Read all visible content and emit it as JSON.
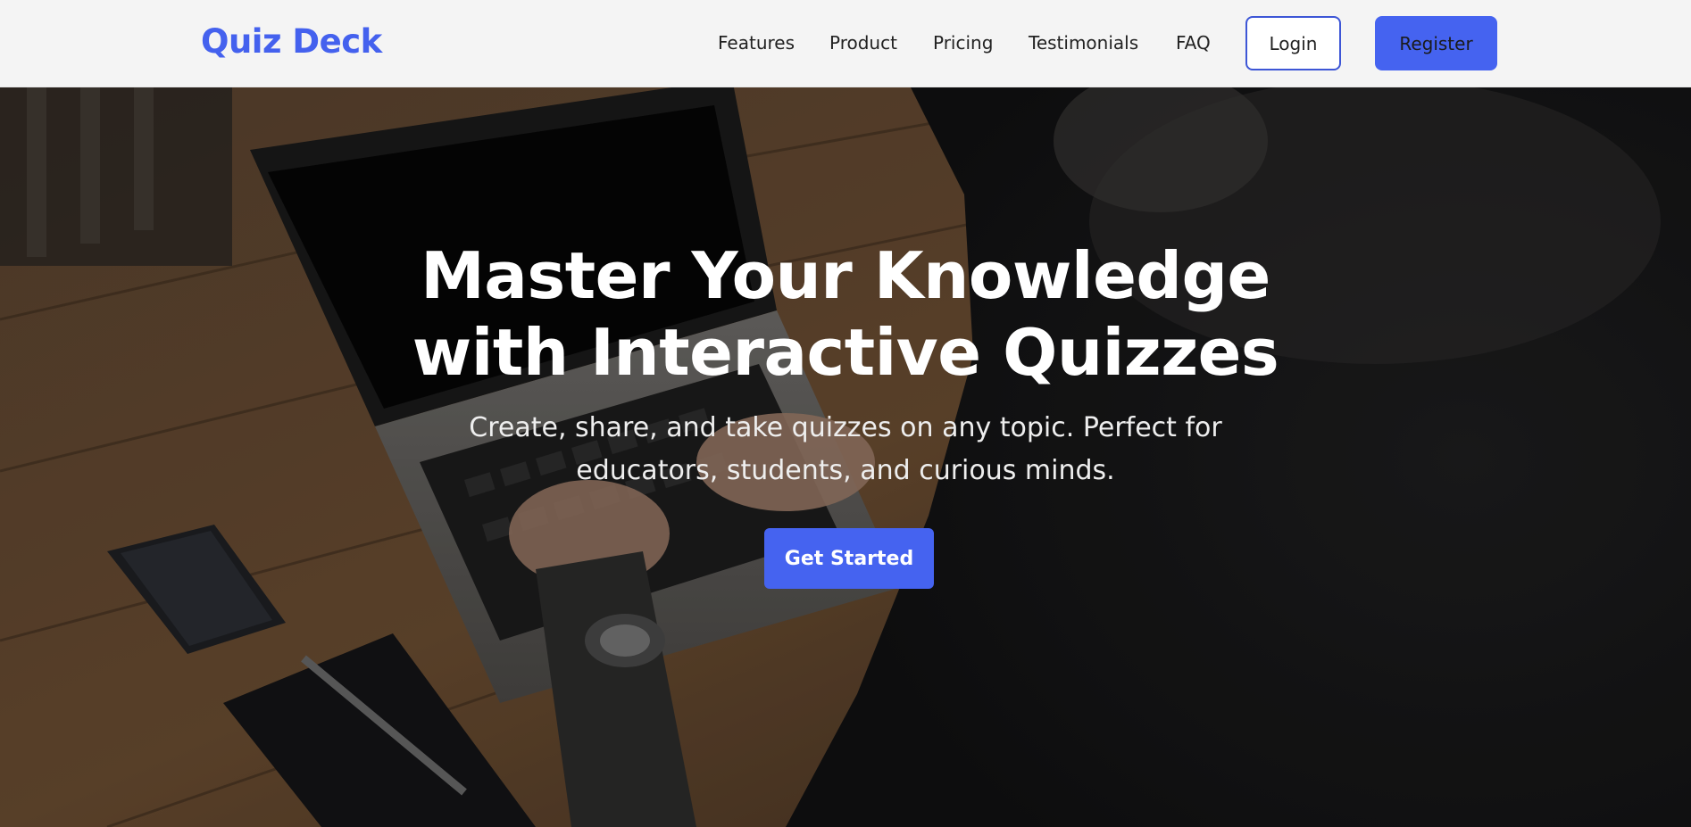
{
  "brand": {
    "name": "Quiz Deck",
    "accent_color": "#4563f0"
  },
  "nav": {
    "links": [
      "Features",
      "Product",
      "Pricing",
      "Testimonials",
      "FAQ"
    ],
    "login_label": "Login",
    "register_label": "Register"
  },
  "hero": {
    "title_line1": "Master Your Knowledge",
    "title_line2": "with Interactive Quizzes",
    "subtitle_line1": "Create, share, and take quizzes on any topic. Perfect for",
    "subtitle_line2": "educators, students, and curious minds.",
    "cta_label": "Get Started",
    "background_image": "person-typing-on-laptop-photo"
  }
}
